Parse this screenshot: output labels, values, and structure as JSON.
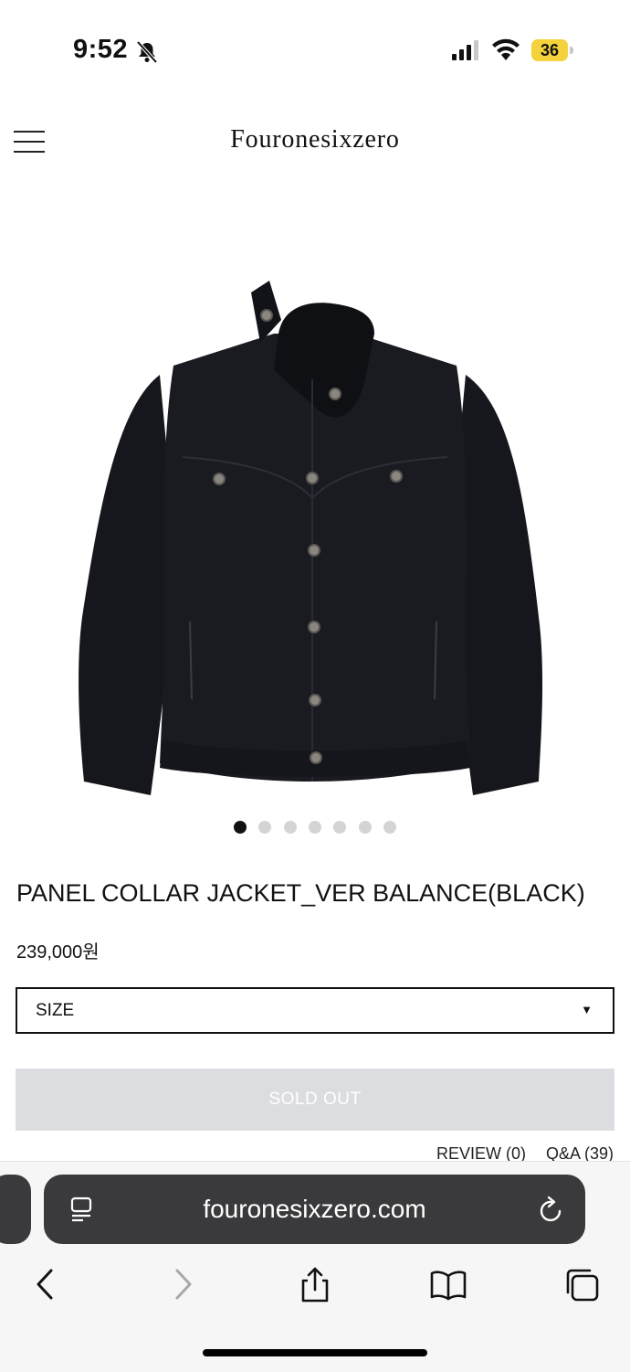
{
  "status_bar": {
    "time": "9:52",
    "battery": "36"
  },
  "header": {
    "brand": "Fouronesixzero"
  },
  "gallery": {
    "slide_count": 7,
    "active_index": 0
  },
  "product": {
    "name": "PANEL COLLAR JACKET_VER BALANCE(BLACK)",
    "price": "239,000원",
    "size_select_label": "SIZE",
    "sold_out_label": "SOLD OUT"
  },
  "tabs": {
    "review": "REVIEW (0)",
    "qa": "Q&A (39)"
  },
  "browser": {
    "url": "fouronesixzero.com"
  },
  "colors": {
    "sold_out_bg": "#dcdde0",
    "battery": "#f4d23c",
    "address_bar": "#3a3a3c"
  }
}
